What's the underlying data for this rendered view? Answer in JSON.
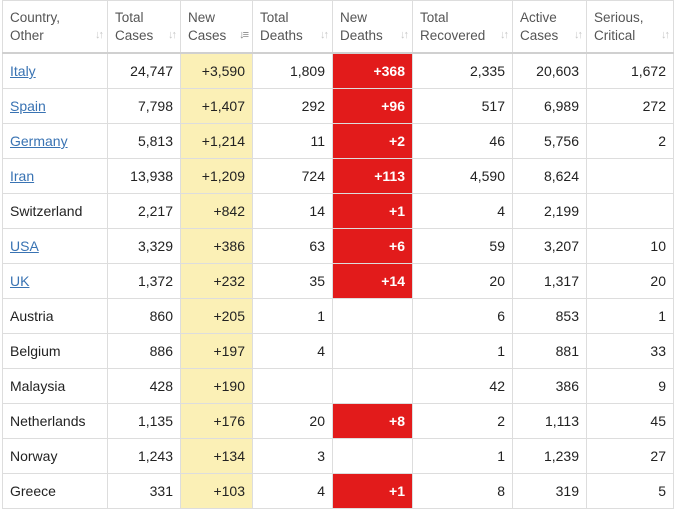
{
  "columns": [
    {
      "l1": "Country,",
      "l2": "Other"
    },
    {
      "l1": "Total",
      "l2": "Cases"
    },
    {
      "l1": "New",
      "l2": "Cases"
    },
    {
      "l1": "Total",
      "l2": "Deaths"
    },
    {
      "l1": "New",
      "l2": "Deaths"
    },
    {
      "l1": "Total",
      "l2": "Recovered"
    },
    {
      "l1": "Active",
      "l2": "Cases"
    },
    {
      "l1": "Serious,",
      "l2": "Critical"
    }
  ],
  "colors": {
    "new_cases_bg": "#fbf0b6",
    "new_deaths_bg": "#e21b1b",
    "link": "#3973b3"
  },
  "rows": [
    {
      "country": "Italy",
      "link": true,
      "total_cases": "24,747",
      "new_cases": "+3,590",
      "total_deaths": "1,809",
      "new_deaths": "+368",
      "total_recovered": "2,335",
      "active_cases": "20,603",
      "serious_critical": "1,672"
    },
    {
      "country": "Spain",
      "link": true,
      "total_cases": "7,798",
      "new_cases": "+1,407",
      "total_deaths": "292",
      "new_deaths": "+96",
      "total_recovered": "517",
      "active_cases": "6,989",
      "serious_critical": "272"
    },
    {
      "country": "Germany",
      "link": true,
      "total_cases": "5,813",
      "new_cases": "+1,214",
      "total_deaths": "11",
      "new_deaths": "+2",
      "total_recovered": "46",
      "active_cases": "5,756",
      "serious_critical": "2"
    },
    {
      "country": "Iran",
      "link": true,
      "total_cases": "13,938",
      "new_cases": "+1,209",
      "total_deaths": "724",
      "new_deaths": "+113",
      "total_recovered": "4,590",
      "active_cases": "8,624",
      "serious_critical": ""
    },
    {
      "country": "Switzerland",
      "link": false,
      "total_cases": "2,217",
      "new_cases": "+842",
      "total_deaths": "14",
      "new_deaths": "+1",
      "total_recovered": "4",
      "active_cases": "2,199",
      "serious_critical": ""
    },
    {
      "country": "USA",
      "link": true,
      "total_cases": "3,329",
      "new_cases": "+386",
      "total_deaths": "63",
      "new_deaths": "+6",
      "total_recovered": "59",
      "active_cases": "3,207",
      "serious_critical": "10"
    },
    {
      "country": "UK",
      "link": true,
      "total_cases": "1,372",
      "new_cases": "+232",
      "total_deaths": "35",
      "new_deaths": "+14",
      "total_recovered": "20",
      "active_cases": "1,317",
      "serious_critical": "20"
    },
    {
      "country": "Austria",
      "link": false,
      "total_cases": "860",
      "new_cases": "+205",
      "total_deaths": "1",
      "new_deaths": "",
      "total_recovered": "6",
      "active_cases": "853",
      "serious_critical": "1"
    },
    {
      "country": "Belgium",
      "link": false,
      "total_cases": "886",
      "new_cases": "+197",
      "total_deaths": "4",
      "new_deaths": "",
      "total_recovered": "1",
      "active_cases": "881",
      "serious_critical": "33"
    },
    {
      "country": "Malaysia",
      "link": false,
      "total_cases": "428",
      "new_cases": "+190",
      "total_deaths": "",
      "new_deaths": "",
      "total_recovered": "42",
      "active_cases": "386",
      "serious_critical": "9"
    },
    {
      "country": "Netherlands",
      "link": false,
      "total_cases": "1,135",
      "new_cases": "+176",
      "total_deaths": "20",
      "new_deaths": "+8",
      "total_recovered": "2",
      "active_cases": "1,113",
      "serious_critical": "45"
    },
    {
      "country": "Norway",
      "link": false,
      "total_cases": "1,243",
      "new_cases": "+134",
      "total_deaths": "3",
      "new_deaths": "",
      "total_recovered": "1",
      "active_cases": "1,239",
      "serious_critical": "27"
    },
    {
      "country": "Greece",
      "link": false,
      "total_cases": "331",
      "new_cases": "+103",
      "total_deaths": "4",
      "new_deaths": "+1",
      "total_recovered": "8",
      "active_cases": "319",
      "serious_critical": "5"
    }
  ]
}
